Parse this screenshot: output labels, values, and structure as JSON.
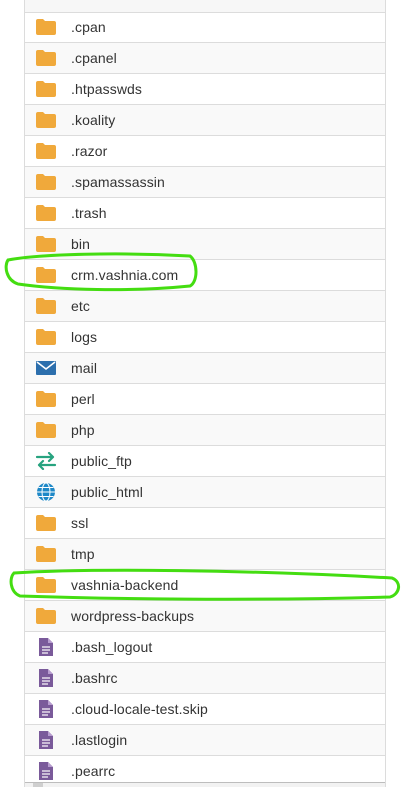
{
  "file_list": {
    "rows": [
      {
        "name": ".cpan",
        "icon": "folder-icon"
      },
      {
        "name": ".cpanel",
        "icon": "folder-icon"
      },
      {
        "name": ".htpasswds",
        "icon": "folder-icon"
      },
      {
        "name": ".koality",
        "icon": "folder-icon"
      },
      {
        "name": ".razor",
        "icon": "folder-icon"
      },
      {
        "name": ".spamassassin",
        "icon": "folder-icon"
      },
      {
        "name": ".trash",
        "icon": "folder-icon"
      },
      {
        "name": "bin",
        "icon": "folder-icon"
      },
      {
        "name": "crm.vashnia.com",
        "icon": "folder-icon"
      },
      {
        "name": "etc",
        "icon": "folder-icon"
      },
      {
        "name": "logs",
        "icon": "folder-icon"
      },
      {
        "name": "mail",
        "icon": "mail-icon"
      },
      {
        "name": "perl",
        "icon": "folder-icon"
      },
      {
        "name": "php",
        "icon": "folder-icon"
      },
      {
        "name": "public_ftp",
        "icon": "transfer-arrows-icon"
      },
      {
        "name": "public_html",
        "icon": "globe-icon"
      },
      {
        "name": "ssl",
        "icon": "folder-icon"
      },
      {
        "name": "tmp",
        "icon": "folder-icon"
      },
      {
        "name": "vashnia-backend",
        "icon": "folder-icon"
      },
      {
        "name": "wordpress-backups",
        "icon": "folder-icon"
      },
      {
        "name": ".bash_logout",
        "icon": "file-icon"
      },
      {
        "name": ".bashrc",
        "icon": "file-icon"
      },
      {
        "name": ".cloud-locale-test.skip",
        "icon": "file-icon"
      },
      {
        "name": ".lastlogin",
        "icon": "file-icon"
      },
      {
        "name": ".pearrc",
        "icon": "file-icon"
      }
    ]
  },
  "colors": {
    "folder": "#f0a93b",
    "mail": "#2c6fad",
    "ftp": "#27a37f",
    "globe": "#1e88c7",
    "file": "#7a5a9a",
    "annotation": "#44dd11"
  }
}
